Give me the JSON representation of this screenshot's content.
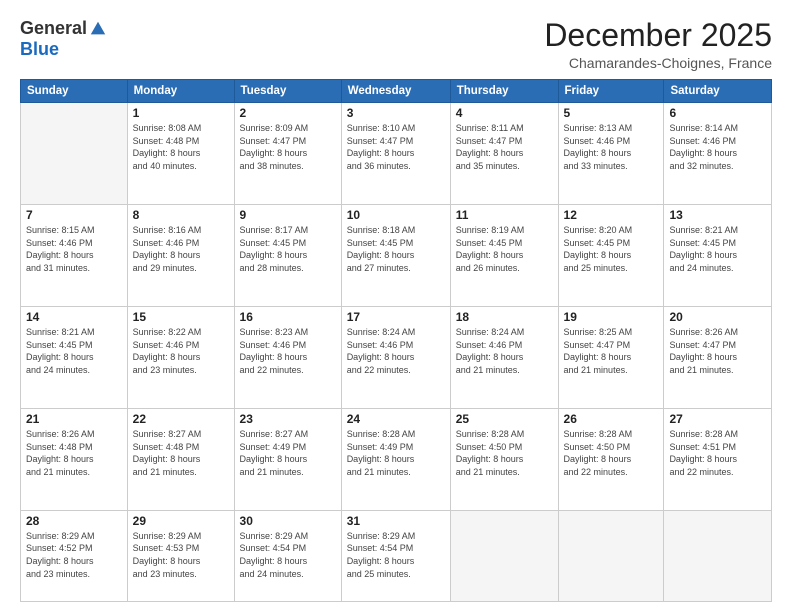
{
  "logo": {
    "general": "General",
    "blue": "Blue"
  },
  "title": "December 2025",
  "subtitle": "Chamarandes-Choignes, France",
  "headers": [
    "Sunday",
    "Monday",
    "Tuesday",
    "Wednesday",
    "Thursday",
    "Friday",
    "Saturday"
  ],
  "weeks": [
    [
      {
        "day": "",
        "info": ""
      },
      {
        "day": "1",
        "info": "Sunrise: 8:08 AM\nSunset: 4:48 PM\nDaylight: 8 hours\nand 40 minutes."
      },
      {
        "day": "2",
        "info": "Sunrise: 8:09 AM\nSunset: 4:47 PM\nDaylight: 8 hours\nand 38 minutes."
      },
      {
        "day": "3",
        "info": "Sunrise: 8:10 AM\nSunset: 4:47 PM\nDaylight: 8 hours\nand 36 minutes."
      },
      {
        "day": "4",
        "info": "Sunrise: 8:11 AM\nSunset: 4:47 PM\nDaylight: 8 hours\nand 35 minutes."
      },
      {
        "day": "5",
        "info": "Sunrise: 8:13 AM\nSunset: 4:46 PM\nDaylight: 8 hours\nand 33 minutes."
      },
      {
        "day": "6",
        "info": "Sunrise: 8:14 AM\nSunset: 4:46 PM\nDaylight: 8 hours\nand 32 minutes."
      }
    ],
    [
      {
        "day": "7",
        "info": "Sunrise: 8:15 AM\nSunset: 4:46 PM\nDaylight: 8 hours\nand 31 minutes."
      },
      {
        "day": "8",
        "info": "Sunrise: 8:16 AM\nSunset: 4:46 PM\nDaylight: 8 hours\nand 29 minutes."
      },
      {
        "day": "9",
        "info": "Sunrise: 8:17 AM\nSunset: 4:45 PM\nDaylight: 8 hours\nand 28 minutes."
      },
      {
        "day": "10",
        "info": "Sunrise: 8:18 AM\nSunset: 4:45 PM\nDaylight: 8 hours\nand 27 minutes."
      },
      {
        "day": "11",
        "info": "Sunrise: 8:19 AM\nSunset: 4:45 PM\nDaylight: 8 hours\nand 26 minutes."
      },
      {
        "day": "12",
        "info": "Sunrise: 8:20 AM\nSunset: 4:45 PM\nDaylight: 8 hours\nand 25 minutes."
      },
      {
        "day": "13",
        "info": "Sunrise: 8:21 AM\nSunset: 4:45 PM\nDaylight: 8 hours\nand 24 minutes."
      }
    ],
    [
      {
        "day": "14",
        "info": "Sunrise: 8:21 AM\nSunset: 4:45 PM\nDaylight: 8 hours\nand 24 minutes."
      },
      {
        "day": "15",
        "info": "Sunrise: 8:22 AM\nSunset: 4:46 PM\nDaylight: 8 hours\nand 23 minutes."
      },
      {
        "day": "16",
        "info": "Sunrise: 8:23 AM\nSunset: 4:46 PM\nDaylight: 8 hours\nand 22 minutes."
      },
      {
        "day": "17",
        "info": "Sunrise: 8:24 AM\nSunset: 4:46 PM\nDaylight: 8 hours\nand 22 minutes."
      },
      {
        "day": "18",
        "info": "Sunrise: 8:24 AM\nSunset: 4:46 PM\nDaylight: 8 hours\nand 21 minutes."
      },
      {
        "day": "19",
        "info": "Sunrise: 8:25 AM\nSunset: 4:47 PM\nDaylight: 8 hours\nand 21 minutes."
      },
      {
        "day": "20",
        "info": "Sunrise: 8:26 AM\nSunset: 4:47 PM\nDaylight: 8 hours\nand 21 minutes."
      }
    ],
    [
      {
        "day": "21",
        "info": "Sunrise: 8:26 AM\nSunset: 4:48 PM\nDaylight: 8 hours\nand 21 minutes."
      },
      {
        "day": "22",
        "info": "Sunrise: 8:27 AM\nSunset: 4:48 PM\nDaylight: 8 hours\nand 21 minutes."
      },
      {
        "day": "23",
        "info": "Sunrise: 8:27 AM\nSunset: 4:49 PM\nDaylight: 8 hours\nand 21 minutes."
      },
      {
        "day": "24",
        "info": "Sunrise: 8:28 AM\nSunset: 4:49 PM\nDaylight: 8 hours\nand 21 minutes."
      },
      {
        "day": "25",
        "info": "Sunrise: 8:28 AM\nSunset: 4:50 PM\nDaylight: 8 hours\nand 21 minutes."
      },
      {
        "day": "26",
        "info": "Sunrise: 8:28 AM\nSunset: 4:50 PM\nDaylight: 8 hours\nand 22 minutes."
      },
      {
        "day": "27",
        "info": "Sunrise: 8:28 AM\nSunset: 4:51 PM\nDaylight: 8 hours\nand 22 minutes."
      }
    ],
    [
      {
        "day": "28",
        "info": "Sunrise: 8:29 AM\nSunset: 4:52 PM\nDaylight: 8 hours\nand 23 minutes."
      },
      {
        "day": "29",
        "info": "Sunrise: 8:29 AM\nSunset: 4:53 PM\nDaylight: 8 hours\nand 23 minutes."
      },
      {
        "day": "30",
        "info": "Sunrise: 8:29 AM\nSunset: 4:54 PM\nDaylight: 8 hours\nand 24 minutes."
      },
      {
        "day": "31",
        "info": "Sunrise: 8:29 AM\nSunset: 4:54 PM\nDaylight: 8 hours\nand 25 minutes."
      },
      {
        "day": "",
        "info": ""
      },
      {
        "day": "",
        "info": ""
      },
      {
        "day": "",
        "info": ""
      }
    ]
  ]
}
